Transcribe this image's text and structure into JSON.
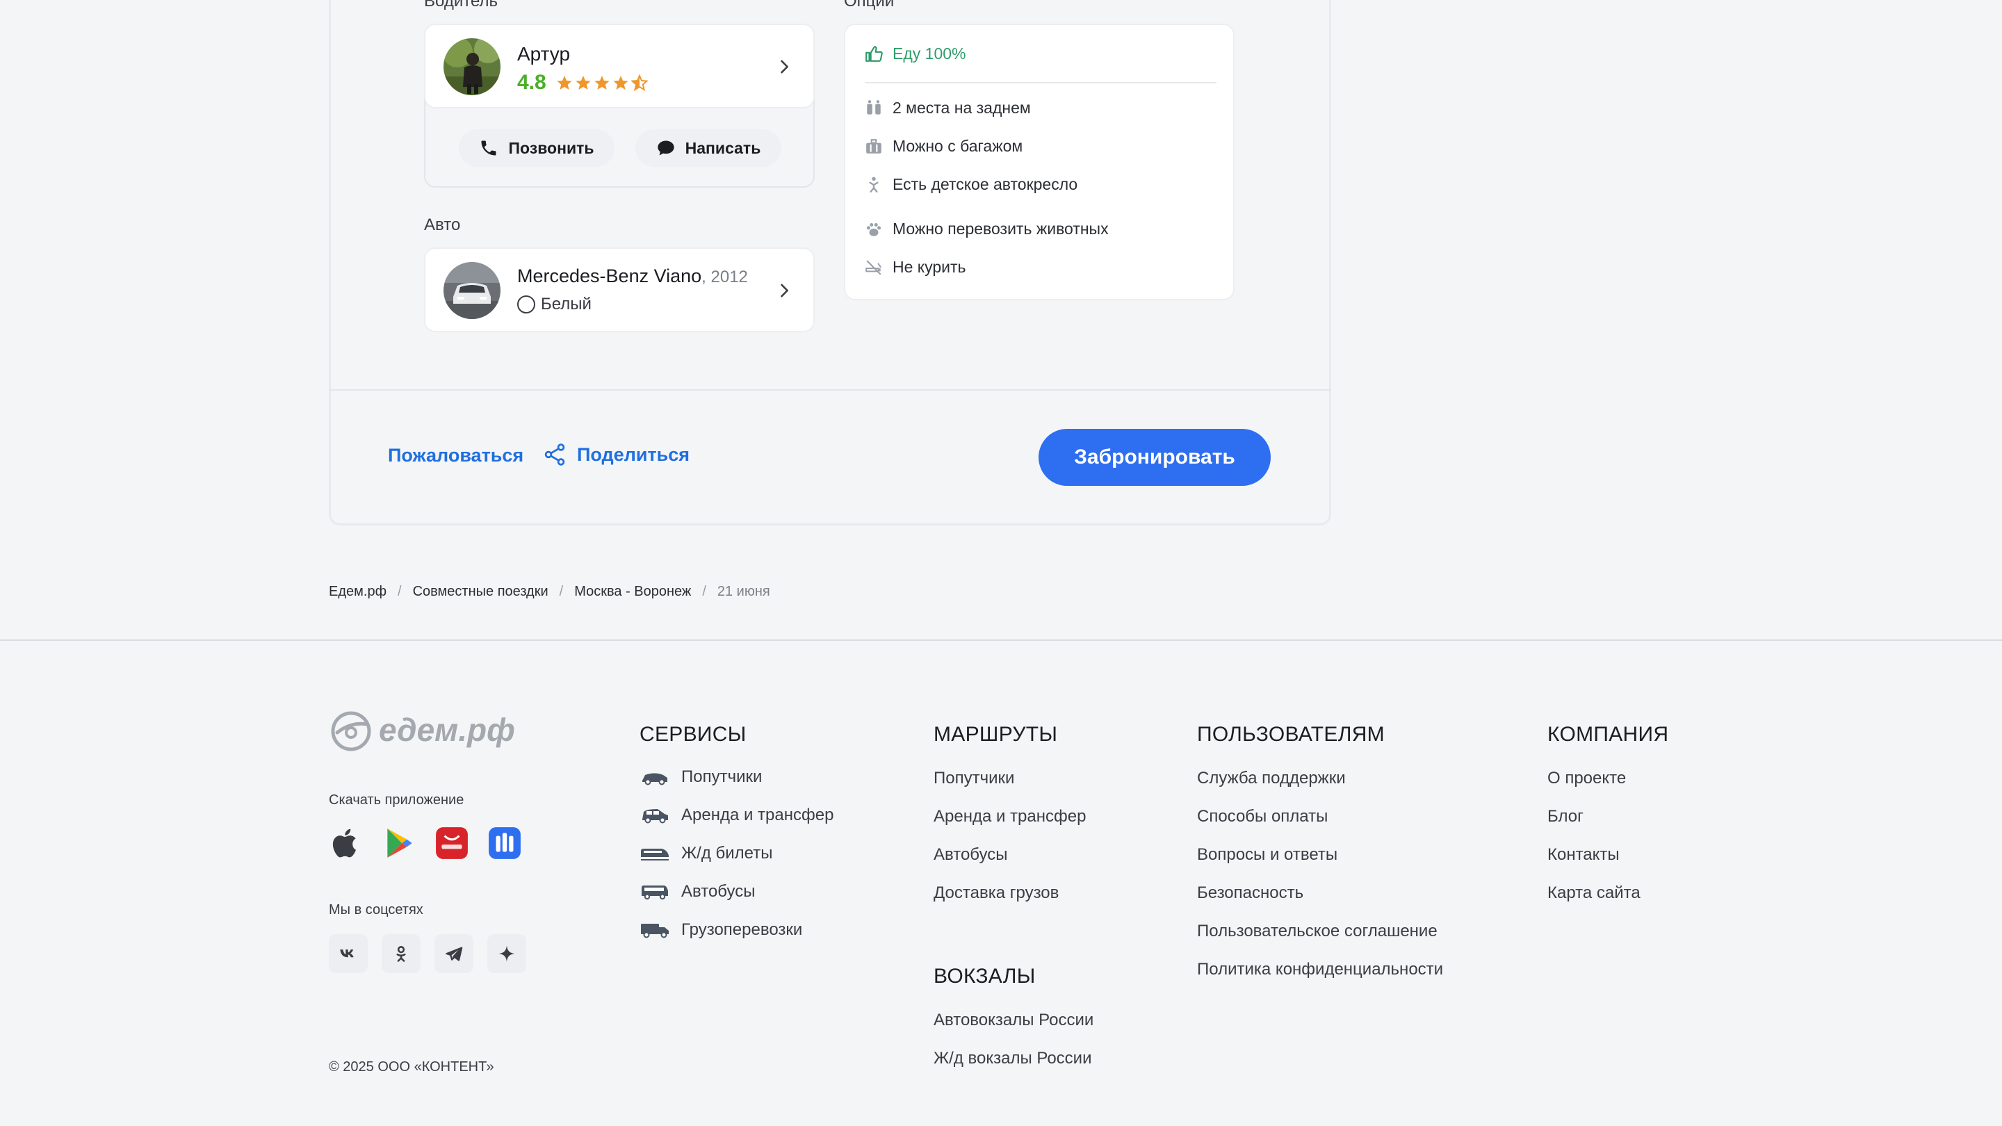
{
  "driver": {
    "section_label": "Водитель",
    "name": "Артур",
    "rating": "4.8",
    "call_label": "Позвонить",
    "message_label": "Написать"
  },
  "car": {
    "section_label": "Авто",
    "model": "Mercedes-Benz Viano",
    "year": ", 2012",
    "color": "Белый"
  },
  "options": {
    "section_label": "Опции",
    "highlight": "Еду 100%",
    "items": [
      {
        "icon": "seats-icon",
        "label": "2 места на заднем"
      },
      {
        "icon": "luggage-icon",
        "label": "Можно с багажом"
      },
      {
        "icon": "child-seat-icon",
        "label": "Есть детское автокресло"
      },
      {
        "icon": "paw-icon",
        "label": "Можно перевозить животных"
      },
      {
        "icon": "no-smoking-icon",
        "label": "Не курить"
      }
    ]
  },
  "actions": {
    "complain": "Пожаловаться",
    "share": "Поделиться",
    "book": "Забронировать"
  },
  "breadcrumb": [
    "Едем.рф",
    "Совместные поездки",
    "Москва - Воронеж",
    "21 июня"
  ],
  "footer": {
    "logo_text": "едем.рф",
    "download_label": "Скачать приложение",
    "social_label": "Мы в соцсетях",
    "copyright": "© 2025 ООО «КОНТЕНТ»",
    "services": {
      "title": "СЕРВИСЫ",
      "items": [
        "Попутчики",
        "Аренда и трансфер",
        "Ж/д билеты",
        "Автобусы",
        "Грузоперевозки"
      ]
    },
    "routes": {
      "title": "МАРШРУТЫ",
      "items": [
        "Попутчики",
        "Аренда и трансфер",
        "Автобусы",
        "Доставка грузов"
      ]
    },
    "stations": {
      "title": "ВОКЗАЛЫ",
      "items": [
        "Автовокзалы России",
        "Ж/д вокзалы России"
      ]
    },
    "users": {
      "title": "ПОЛЬЗОВАТЕЛЯМ",
      "items": [
        "Служба поддержки",
        "Способы оплаты",
        "Вопросы и ответы",
        "Безопасность",
        "Пользовательское соглашение",
        "Политика конфиденциальности"
      ]
    },
    "company": {
      "title": "КОМПАНИЯ",
      "items": [
        "О проекте",
        "Блог",
        "Контакты",
        "Карта сайта"
      ]
    }
  },
  "colors": {
    "accent": "#2e6ef0",
    "link": "#1f6fe0",
    "rating_green": "#4caf2a",
    "star_orange": "#f0962a",
    "option_green": "#2e9c6a"
  }
}
